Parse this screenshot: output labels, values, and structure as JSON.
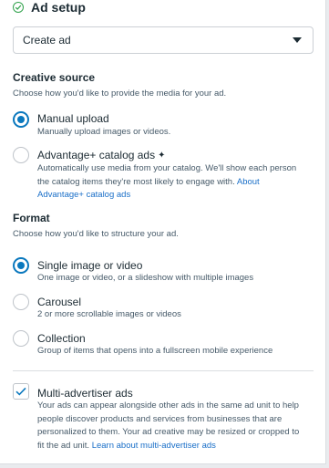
{
  "section": {
    "title": "Ad setup",
    "status_icon": "check-circle-icon",
    "status_color": "#31a24c"
  },
  "ad_select": {
    "value": "Create ad"
  },
  "creative_source": {
    "title": "Creative source",
    "description": "Choose how you'd like to provide the media for your ad.",
    "options": [
      {
        "label": "Manual upload",
        "description": "Manually upload images or videos.",
        "selected": true
      },
      {
        "label": "Advantage+ catalog ads",
        "icon": "sparkle-icon",
        "description_lines": [
          "Automatically use media from your catalog. We'll show each person",
          "the catalog items they're most likely to engage with."
        ],
        "link_inline": "About",
        "link_line2": "Advantage+ catalog ads",
        "selected": false
      }
    ]
  },
  "format": {
    "title": "Format",
    "description": "Choose how you'd like to structure your ad.",
    "options": [
      {
        "label": "Single image or video",
        "description": "One image or video, or a slideshow with multiple images",
        "selected": true
      },
      {
        "label": "Carousel",
        "description": "2 or more scrollable images or videos",
        "selected": false
      },
      {
        "label": "Collection",
        "description": "Group of items that opens into a fullscreen mobile experience",
        "selected": false
      }
    ]
  },
  "multi_advertiser": {
    "label": "Multi-advertiser ads",
    "checked": true,
    "description_lines": [
      "Your ads can appear alongside other ads in the same ad unit to help",
      "people discover products and services from businesses that are",
      "personalized to them. Your ad creative may be resized or cropped to"
    ],
    "last_line_prefix": "fit the ad unit.",
    "link": "Learn about multi-advertiser ads"
  },
  "colors": {
    "accent": "#0a78be",
    "link": "#1a6fc8",
    "text": "#1c2b33",
    "muted": "#465a69"
  }
}
